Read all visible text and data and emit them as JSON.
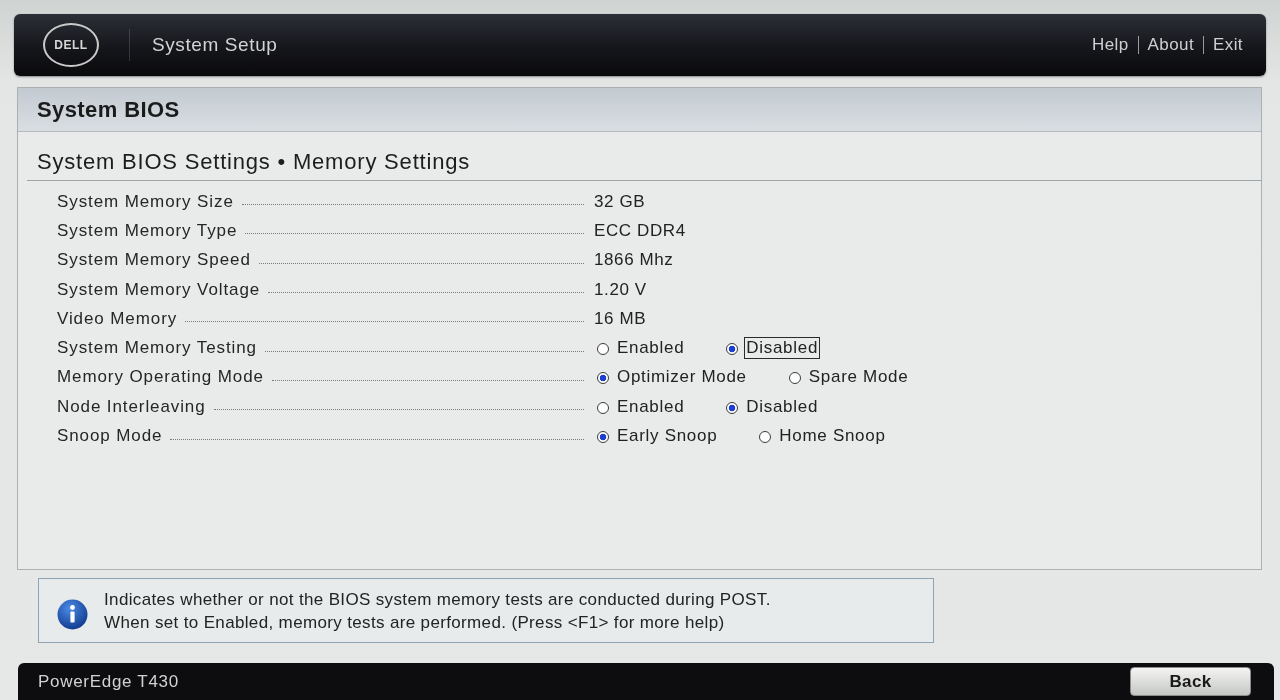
{
  "header": {
    "logo": "DELL",
    "title": "System Setup",
    "links": [
      "Help",
      "About",
      "Exit"
    ]
  },
  "page_title": "System BIOS",
  "breadcrumb": "System BIOS Settings • Memory Settings",
  "settings": [
    {
      "kind": "value",
      "label": "System Memory Size",
      "value": "32 GB"
    },
    {
      "kind": "value",
      "label": "System Memory Type",
      "value": "ECC DDR4"
    },
    {
      "kind": "value",
      "label": "System Memory Speed",
      "value": "1866 Mhz"
    },
    {
      "kind": "value",
      "label": "System Memory Voltage",
      "value": "1.20 V"
    },
    {
      "kind": "value",
      "label": "Video Memory",
      "value": "16 MB"
    },
    {
      "kind": "radio",
      "label": "System Memory Testing",
      "options": [
        {
          "label": "Enabled",
          "selected": false,
          "focused": false
        },
        {
          "label": "Disabled",
          "selected": true,
          "focused": true
        }
      ]
    },
    {
      "kind": "radio",
      "label": "Memory Operating Mode",
      "options": [
        {
          "label": "Optimizer Mode",
          "selected": true,
          "focused": false
        },
        {
          "label": "Spare Mode",
          "selected": false,
          "focused": false
        }
      ]
    },
    {
      "kind": "radio",
      "label": "Node Interleaving",
      "options": [
        {
          "label": "Enabled",
          "selected": false,
          "focused": false
        },
        {
          "label": "Disabled",
          "selected": true,
          "focused": false
        }
      ]
    },
    {
      "kind": "radio",
      "label": "Snoop Mode",
      "options": [
        {
          "label": "Early Snoop",
          "selected": true,
          "focused": false
        },
        {
          "label": "Home Snoop",
          "selected": false,
          "focused": false
        }
      ]
    }
  ],
  "help": {
    "lines": [
      "Indicates whether or not the BIOS system memory tests are conducted during POST.",
      "When set to Enabled, memory tests are performed. (Press <F1> for more help)"
    ]
  },
  "footer": {
    "model": "PowerEdge T430",
    "back_button": "Back"
  }
}
